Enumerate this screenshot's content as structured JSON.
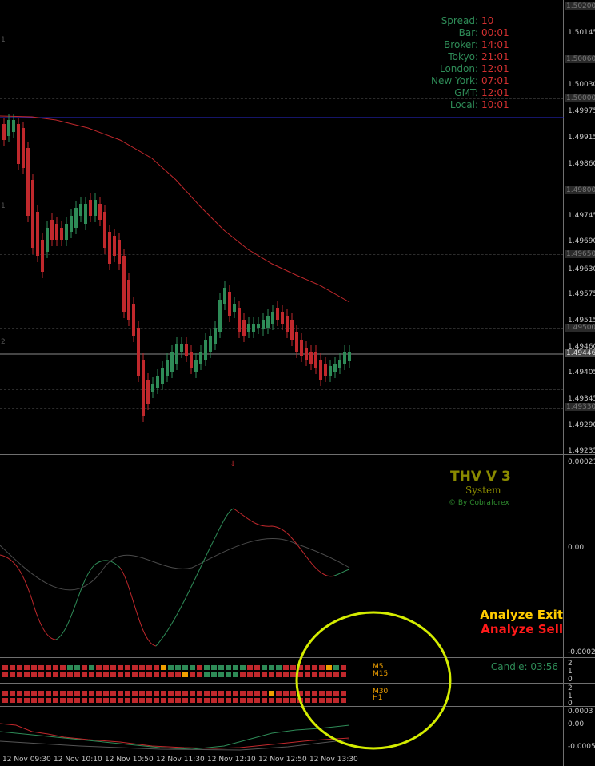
{
  "info_panel": [
    {
      "k": "Spread:",
      "v": "10"
    },
    {
      "k": "Bar:",
      "v": "00:01"
    },
    {
      "k": "Broker:",
      "v": "14:01"
    },
    {
      "k": "Tokyo:",
      "v": "21:01"
    },
    {
      "k": "London:",
      "v": "12:01"
    },
    {
      "k": "New York:",
      "v": "07:01"
    },
    {
      "k": "GMT:",
      "v": "12:01"
    },
    {
      "k": "Local:",
      "v": "10:01"
    }
  ],
  "price_scale": [
    "1.50200",
    "1.50145",
    "1.50060",
    "1.50030",
    "1.50000",
    "1.49975",
    "1.49915",
    "1.49860",
    "1.49800",
    "1.49745",
    "1.49690",
    "1.49650",
    "1.49630",
    "1.49575",
    "1.49515",
    "1.49500",
    "1.49460",
    "1.49446",
    "1.49405",
    "1.49345",
    "1.49330",
    "1.49290",
    "1.49235"
  ],
  "price_boxes": [
    "1.50200",
    "1.50060",
    "1.50000",
    "1.49800",
    "1.49650",
    "1.49500",
    "1.49446",
    "1.49330"
  ],
  "indicator_scale": {
    "top": "0.000214",
    "mid": "0.00",
    "bottom": "-0.00025"
  },
  "bars_scale": [
    "2",
    "1",
    "0",
    "2",
    "1",
    "0"
  ],
  "bottom_scale": [
    "0.0003",
    "0.00",
    "-0.0005"
  ],
  "left_marks": [
    "1",
    "1",
    "2"
  ],
  "thv": {
    "title": "THV V 3",
    "subtitle": "System",
    "credit": "© By Cobraforex"
  },
  "analyze": {
    "exit": "Analyze Exit",
    "sell": "Analyze Sell"
  },
  "timeframes": {
    "row1_top": "M5",
    "row1_bottom": "M15",
    "row2_top": "M30",
    "row2_bottom": "H1"
  },
  "candle_timer": "Candle:  03:56",
  "time_axis": [
    "12 Nov 09:30",
    "12 Nov 10:10",
    "12 Nov 10:50",
    "12 Nov 11:30",
    "12 Nov 12:10",
    "12 Nov 12:50",
    "12 Nov 13:30"
  ],
  "colors": {
    "bull": "#2e8b57",
    "bear": "#c0282c",
    "ma_red": "#c0282c",
    "blue_line": "#2a2ad0",
    "yellow_circle": "#d4ec00",
    "exit": "#ffcc00",
    "sell": "#ff1a1a",
    "tf_orange": "#f0a000"
  }
}
